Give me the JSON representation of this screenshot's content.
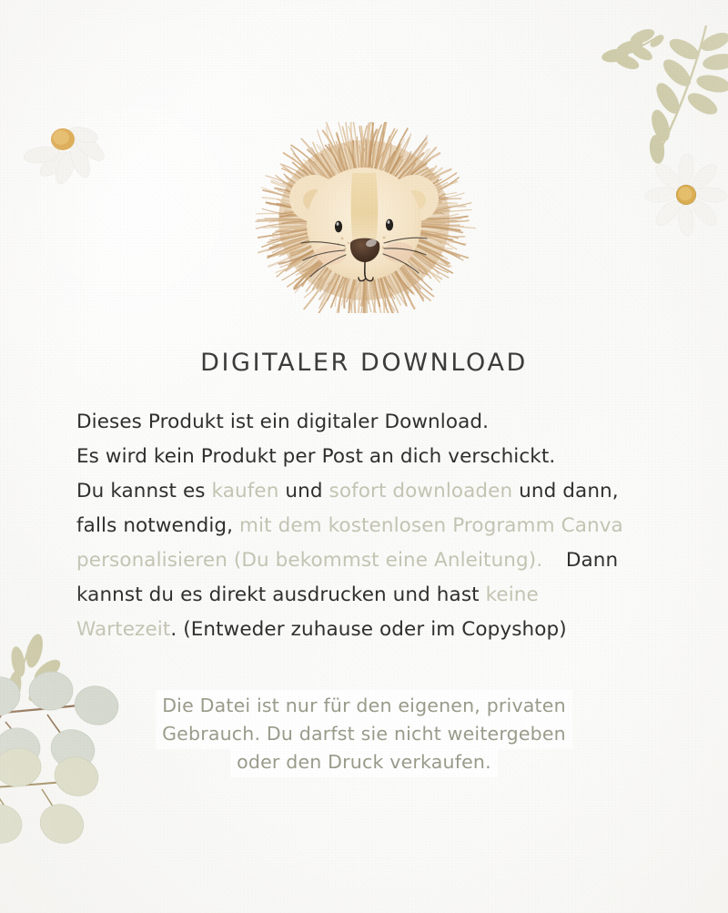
{
  "page": {
    "background_color": "#fafaf8",
    "accent_muted_text_color": "#c4c5b4",
    "body_text_color": "#2f2f2f",
    "notice_text_color": "#9a9b8b",
    "notice_highlight_color": "#ffffff",
    "lion_mane_color": "#c9a373",
    "lion_face_color": "#f7e8cd",
    "branch_olive_color": "#ccc9a4",
    "eucalyptus_sage_color": "#d3d8cd",
    "daisy_center_color": "#d9a githubnone",
    "daisy_petal_color": "#f7f6f2"
  },
  "title": "DIGITALER DOWNLOAD",
  "body": {
    "line1": "Dieses Produkt ist ein digitaler Download.",
    "line2": "Es wird kein Produkt per Post an dich verschickt.",
    "line3_a": "Du kannst es ",
    "line3_muted1": "kaufen",
    "line3_b": " und ",
    "line3_muted2": "sofort downloaden",
    "line3_c": " und dann,",
    "line4_a": "falls notwendig, ",
    "line4_muted": "mit dem kostenlosen Programm Canva",
    "line5_muted": "personalisieren (Du bekommst eine Anleitung).",
    "line5_b": "Dann",
    "line6_a": "kannst du es direkt ausdrucken und hast ",
    "line6_muted": "keine",
    "line7_muted": "Wartezeit",
    "line7_b": ". (Entweder zuhause oder im Copyshop)"
  },
  "notice": {
    "line1": "Die Datei ist nur für den eigenen, privaten",
    "line2": "Gebrauch. Du darfst sie nicht weitergeben",
    "line3": "oder den Druck verkaufen."
  },
  "decorations": {
    "lion": "lion-head-watercolor",
    "branch_topright": "olive-branch",
    "daisy_topleft": "daisy-flower",
    "daisy_right": "daisy-flower",
    "eucalyptus_bottomleft": "eucalyptus-branch"
  }
}
